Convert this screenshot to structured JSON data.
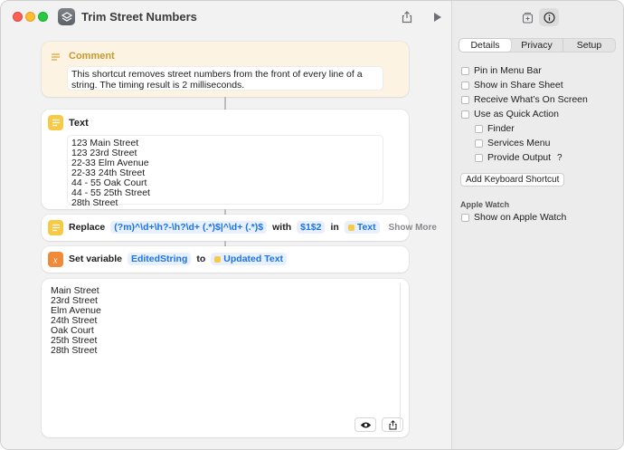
{
  "window": {
    "title": "Trim Street Numbers"
  },
  "actions": {
    "comment": {
      "header": "Comment",
      "text": "This shortcut removes street numbers from the front of every line of a string. The timing result is 2 milliseconds."
    },
    "text": {
      "header": "Text",
      "lines": [
        "123 Main Street",
        "123 23rd Street",
        "22-33 Elm Avenue",
        "22-33 24th Street",
        "44 - 55 Oak Court",
        "44 - 55 25th Street",
        "28th Street"
      ]
    },
    "replace": {
      "label": "Replace",
      "pattern": "(?m)^\\d+\\h?-\\h?\\d+ (.*)$|^\\d+ (.*)$",
      "with_label": "with",
      "replacement": "$1$2",
      "in_label": "in",
      "input_var": "Text",
      "show_more": "Show More"
    },
    "set_variable": {
      "label": "Set variable",
      "name": "EditedString",
      "to_label": "to",
      "value_var": "Updated Text"
    },
    "output": {
      "lines": [
        "Main Street",
        "23rd Street",
        "Elm Avenue",
        "24th Street",
        "Oak Court",
        "25th Street",
        "28th Street"
      ]
    }
  },
  "sidebar": {
    "tabs": [
      "Details",
      "Privacy",
      "Setup"
    ],
    "selected_tab": "Details",
    "options": {
      "pin_menu_bar": "Pin in Menu Bar",
      "share_sheet": "Show in Share Sheet",
      "receive_screen": "Receive What’s On Screen",
      "quick_action": "Use as Quick Action",
      "finder": "Finder",
      "services_menu": "Services Menu",
      "provide_output": "Provide Output",
      "help_mark": "?"
    },
    "keyboard_shortcut_button": "Add Keyboard Shortcut",
    "apple_watch": {
      "section": "Apple Watch",
      "show_on_watch": "Show on Apple Watch"
    }
  },
  "colors": {
    "accent_blue": "#1a73e8",
    "comment_bg": "#fcf3e2",
    "text_icon": "#f7c945",
    "variable_icon": "#f08a3a"
  }
}
